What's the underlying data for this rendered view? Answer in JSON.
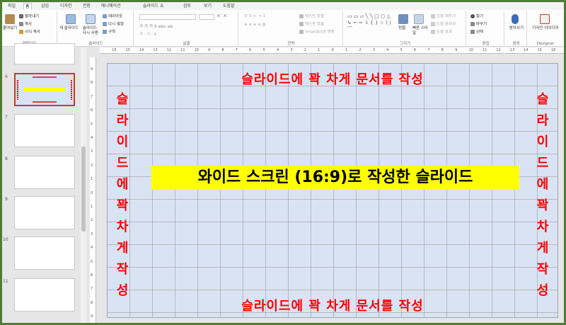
{
  "ribbon": {
    "tabs": [
      "파일",
      "홈",
      "삽입",
      "디자인",
      "전환",
      "애니메이션",
      "슬라이드 쇼",
      "검토",
      "보기",
      "도움말"
    ],
    "clipboard": {
      "paste": "붙여넣기",
      "cut": "잘라내기",
      "copy": "복사",
      "format_copy": "서식 복사",
      "label": "클립보드"
    },
    "slides": {
      "new_slide": "새 슬라이드",
      "reuse": "슬라이드 다시 사용",
      "layout": "레이아웃",
      "reset": "다시 설정",
      "section": "구역",
      "label": "슬라이드"
    },
    "font": {
      "label": "글꼴"
    },
    "paragraph": {
      "text_direction": "텍스트 방향",
      "align_text": "텍스트 맞춤",
      "smartart": "SmartArt로 변환",
      "label": "단락"
    },
    "drawing": {
      "arrange": "정렬",
      "quick_styles": "빠른 스타일",
      "fill": "도형 채우기",
      "outline": "도형 윤곽선",
      "effects": "도형 효과",
      "label": "그리기"
    },
    "editing": {
      "find": "찾기",
      "replace": "바꾸기",
      "select": "선택",
      "label": "편집"
    },
    "voice": {
      "dictate": "받아쓰기",
      "label": "음성"
    },
    "designer": {
      "ideas": "디자인 아이디어",
      "label": "Designer"
    }
  },
  "thumbnails": [
    {
      "num": "",
      "selected": false
    },
    {
      "num": "6",
      "selected": true
    },
    {
      "num": "7",
      "selected": false
    },
    {
      "num": "8",
      "selected": false
    },
    {
      "num": "9",
      "selected": false
    },
    {
      "num": "10",
      "selected": false
    },
    {
      "num": "11",
      "selected": false
    }
  ],
  "ruler": {
    "horizontal": [
      "16",
      "15",
      "14",
      "13",
      "12",
      "11",
      "10",
      "9",
      "8",
      "7",
      "6",
      "5",
      "4",
      "3",
      "2",
      "1",
      "0",
      "1",
      "2",
      "3",
      "4",
      "5",
      "6",
      "7",
      "8",
      "9",
      "10",
      "11",
      "12",
      "13",
      "14",
      "15",
      "16"
    ],
    "vertical": [
      "9",
      "8",
      "7",
      "6",
      "5",
      "4",
      "3",
      "2",
      "1",
      "0",
      "1",
      "2",
      "3",
      "4",
      "5",
      "6",
      "7",
      "8",
      "9"
    ]
  },
  "slide": {
    "top_text": "슬라이드에 꽉 차게 문서를 작성",
    "bottom_text": "슬라이드에 꽉 차게 문서를 작성",
    "side_text": [
      "슬",
      "라",
      "이",
      "드",
      "에",
      "꽉",
      "차",
      "게",
      "작",
      "성"
    ],
    "center_text": "와이드 스크린 (16:9)로 작성한 슬라이드",
    "background_color": "#dae3f3",
    "accent_color": "#ff0000",
    "highlight_color": "#ffff00"
  }
}
